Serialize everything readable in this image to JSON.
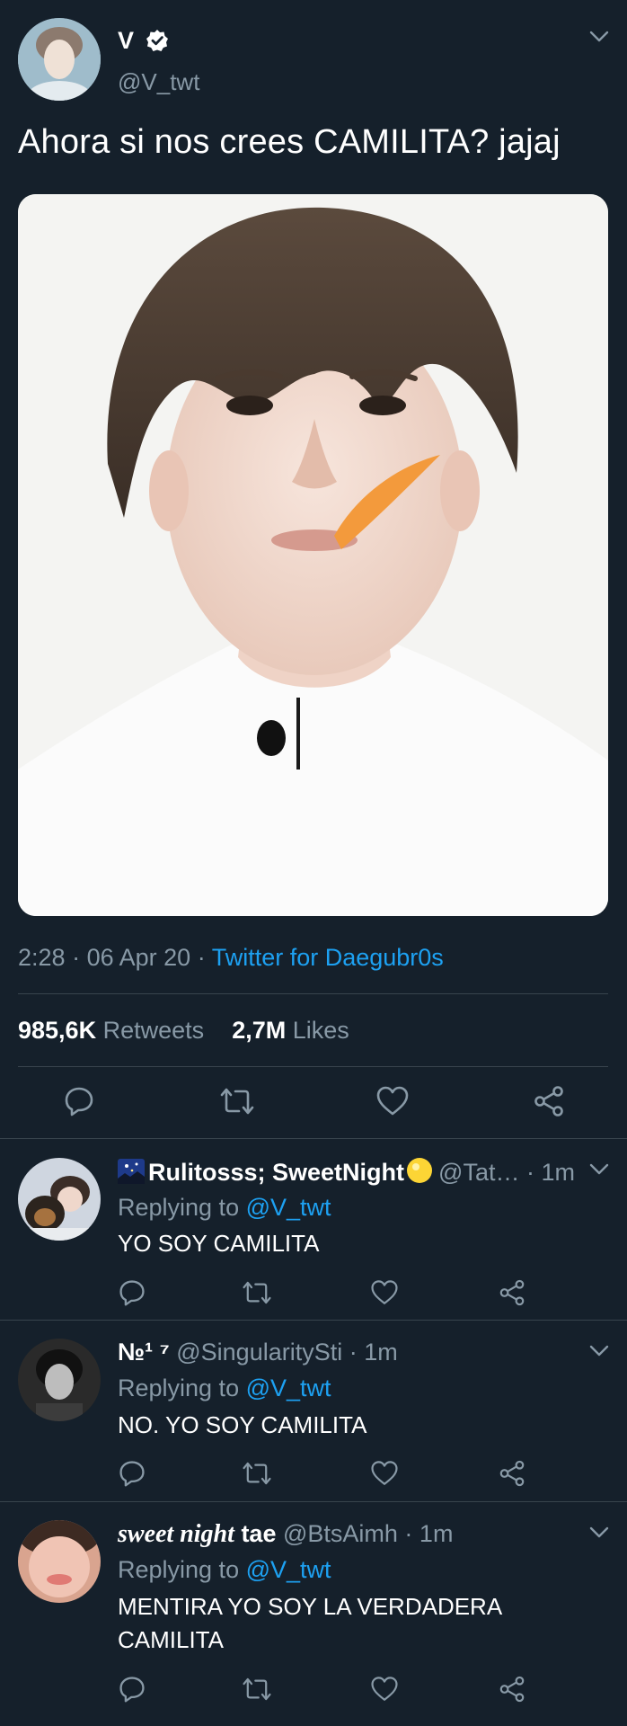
{
  "tweet": {
    "author_name": "V",
    "handle": "@V_twt",
    "text": "Ahora si nos crees CAMILITA? jajaj",
    "time": "2:28",
    "date": "06 Apr 20",
    "source": "Twitter for Daegubr0s",
    "retweets_count": "985,6K",
    "retweets_label": "Retweets",
    "likes_count": "2,7M",
    "likes_label": "Likes"
  },
  "icons": {
    "verified": "verified-badge-icon",
    "caret": "chevron-down-icon",
    "reply": "reply-bubble-icon",
    "retweet": "retweet-icon",
    "like": "heart-icon",
    "share": "share-icon"
  },
  "colors": {
    "background": "#15202b",
    "accent": "#1da1f2",
    "muted": "#8899a6",
    "divider": "#38444d",
    "text": "#ffffff"
  },
  "replying_label": "Replying to",
  "replies": [
    {
      "display_name": "Rulitosss; SweetNight",
      "handle": "@Tat…",
      "time": "1m",
      "replying_to": "@V_twt",
      "text": "YO SOY CAMILITA"
    },
    {
      "display_name": "№¹ ⁷",
      "handle": "@SingularitySti",
      "time": "1m",
      "replying_to": "@V_twt",
      "text": "NO. YO SOY CAMILITA"
    },
    {
      "display_name_italic": "sweet night",
      "display_name_rest": "tae",
      "handle": "@BtsAimh",
      "time": "1m",
      "replying_to": "@V_twt",
      "text": "MENTIRA YO SOY LA VERDADERA CAMILITA"
    }
  ]
}
